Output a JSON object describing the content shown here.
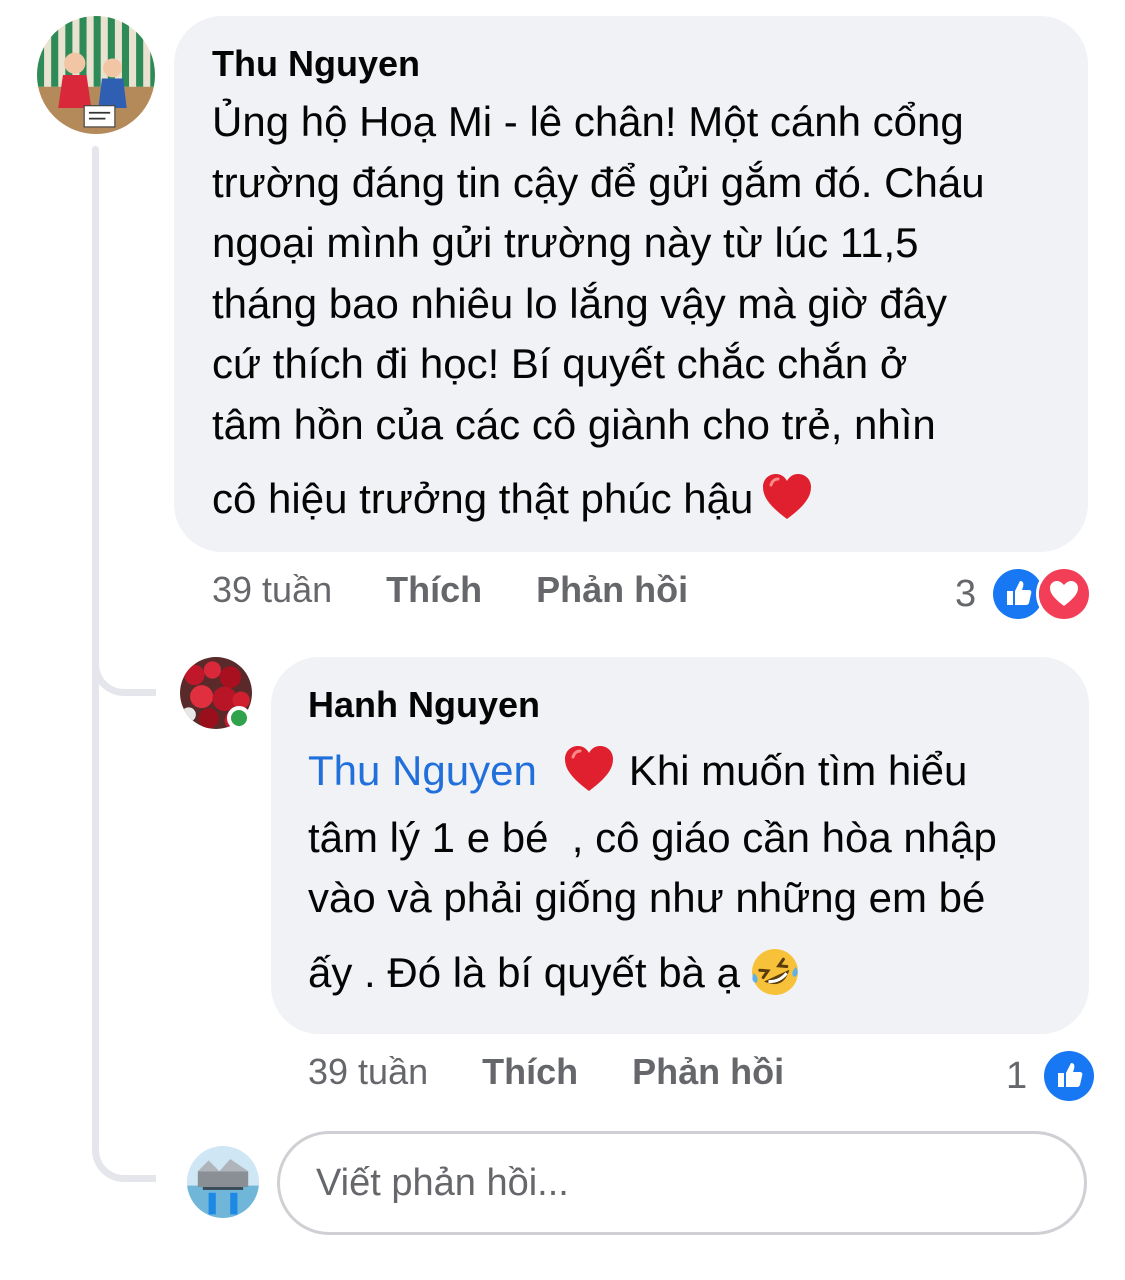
{
  "comment": {
    "author": "Thu Nguyen",
    "text_lines": [
      "Ủng hộ Hoạ Mi - lê chân! Một cánh cổng",
      "trường đáng tin cậy để gửi gắm đó. Cháu",
      "ngoại mình gửi trường này từ lúc 11,5",
      "tháng bao nhiêu lo lắng vậy mà giờ đây",
      "cứ thích đi học! Bí quyết chắc chắn ở",
      "tâm hồn của các cô giành cho trẻ, nhìn",
      "cô hiệu trưởng thật phúc hậu"
    ],
    "time": "39 tuần",
    "like_label": "Thích",
    "reply_label": "Phản hồi",
    "reaction_count": "3",
    "reactions": [
      "like-icon",
      "love-icon"
    ]
  },
  "reply": {
    "author": "Hanh Nguyen",
    "mention": "Thu Nguyen",
    "text_line1_after_mention": "Khi muốn tìm hiểu",
    "text_lines": [
      "tâm lý 1 e bé  , cô giáo cần hòa nhập",
      "vào và phải giống như những em bé",
      "ấy . Đó là bí quyết bà ạ"
    ],
    "time": "39 tuần",
    "like_label": "Thích",
    "reply_label": "Phản hồi",
    "reaction_count": "1",
    "reactions": [
      "like-icon"
    ],
    "online": true
  },
  "reply_box": {
    "placeholder": "Viết phản hồi..."
  },
  "colors": {
    "bubble": "#f0f2f5",
    "mention": "#216fdb",
    "like": "#1877f2",
    "love": "#f33e58",
    "online": "#31a24c",
    "meta_text": "#65676b"
  }
}
